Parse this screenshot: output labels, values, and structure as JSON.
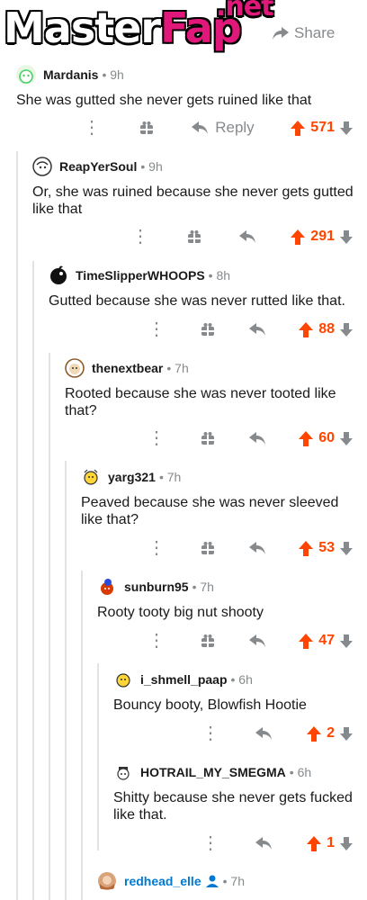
{
  "watermark": {
    "text_main": "Master",
    "text_brand": "Fap",
    "text_tld": ".net"
  },
  "header": {
    "share_label": "Share"
  },
  "comments": [
    {
      "user": "Mardanis",
      "age": "9h",
      "text": "She was gutted she never gets ruined like that",
      "score": "571",
      "reply_label": "Reply"
    },
    {
      "user": "ReapYerSoul",
      "age": "9h",
      "text": "Or, she was ruined because she never gets gutted like that",
      "score": "291"
    },
    {
      "user": "TimeSlipperWHOOPS",
      "age": "8h",
      "text": "Gutted because she was never rutted like that.",
      "score": "88"
    },
    {
      "user": "thenextbear",
      "age": "7h",
      "text": "Rooted because she was never tooted like that?",
      "score": "60"
    },
    {
      "user": "yarg321",
      "age": "7h",
      "text": "Peaved because she was never sleeved like that?",
      "score": "53"
    },
    {
      "user": "sunburn95",
      "age": "7h",
      "text": "Rooty tooty big nut shooty",
      "score": "47"
    },
    {
      "user": "i_shmell_paap",
      "age": "6h",
      "text": "Bouncy booty, Blowfish Hootie",
      "score": "2"
    },
    {
      "user": "HOTRAIL_MY_SMEGMA",
      "age": "6h",
      "text": "Shitty because she never gets fucked like that.",
      "score": "1"
    },
    {
      "user": "redhead_elle",
      "age": "7h",
      "text": ""
    }
  ],
  "age_separator": "•",
  "colors": {
    "upvote": "#ff4500",
    "meta": "#878a8c",
    "thread": "#e3e3e3"
  }
}
